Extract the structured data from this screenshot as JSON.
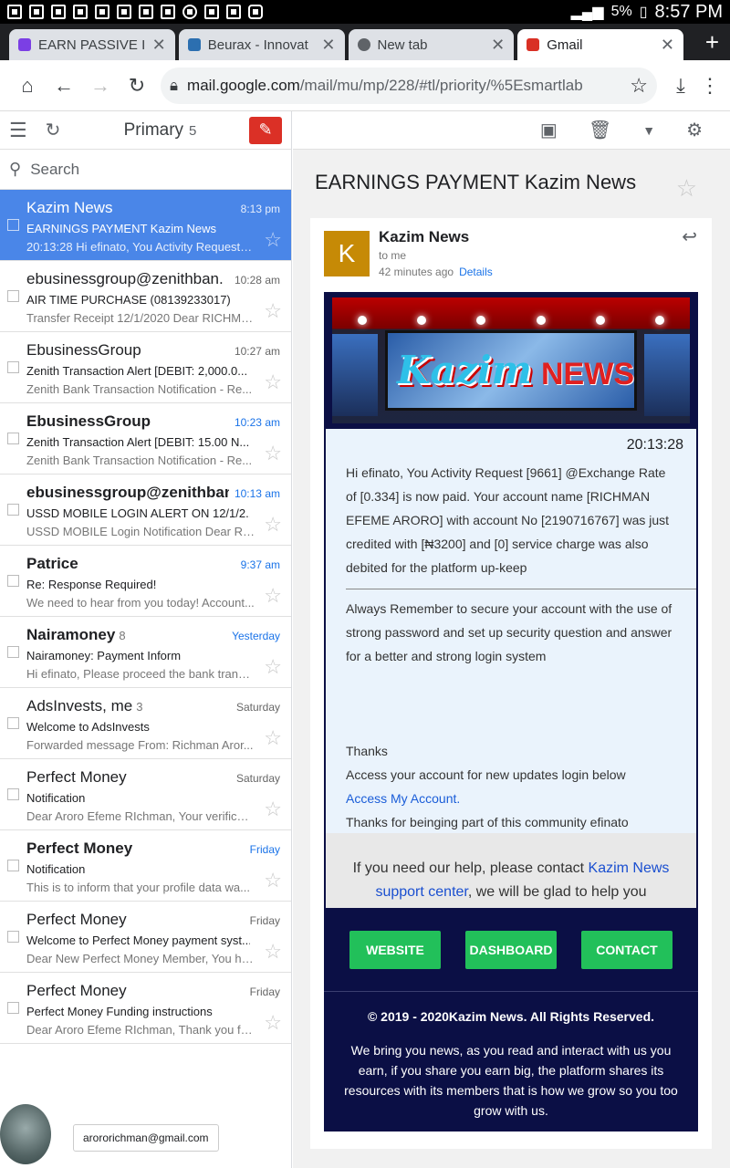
{
  "status_bar": {
    "battery": "5%",
    "time": "8:57 PM"
  },
  "tabs": [
    {
      "title": "EARN PASSIVE I",
      "favicon_color": "#7b3fe4",
      "active": false
    },
    {
      "title": "Beurax - Innovat",
      "favicon_color": "#2c6fb0",
      "active": false
    },
    {
      "title": "New tab",
      "favicon_color": "#5f6368",
      "active": false
    },
    {
      "title": "Gmail",
      "favicon_color": "#d93025",
      "active": true
    }
  ],
  "address_bar": {
    "url_host": "mail.google.com",
    "url_path": "/mail/mu/mp/228/#tl/priority/%5Esmartlab"
  },
  "inbox": {
    "folder": "Primary",
    "count": "5",
    "search_placeholder": "Search",
    "mails": [
      {
        "sender": "Kazim News",
        "thread_count": "",
        "time": "8:13 pm",
        "subject": "EARNINGS PAYMENT Kazim News",
        "snippet": "20:13:28 Hi efinato, You Activity Request [...",
        "unread": false,
        "time_blue": false,
        "selected": true
      },
      {
        "sender": "ebusinessgroup@zenithban.",
        "thread_count": "",
        "time": "10:28 am",
        "subject": "AIR TIME PURCHASE (08139233017)",
        "snippet": "Transfer Receipt 12/1/2020 Dear RICHMAN...",
        "unread": false,
        "time_blue": false,
        "selected": false
      },
      {
        "sender": "EbusinessGroup",
        "thread_count": "",
        "time": "10:27 am",
        "subject": "Zenith Transaction Alert [DEBIT: 2,000.0...",
        "snippet": "Zenith Bank Transaction Notification - Re...",
        "unread": false,
        "time_blue": false,
        "selected": false
      },
      {
        "sender": "EbusinessGroup",
        "thread_count": "",
        "time": "10:23 am",
        "subject": "Zenith Transaction Alert [DEBIT: 15.00 N...",
        "snippet": "Zenith Bank Transaction Notification - Re...",
        "unread": true,
        "time_blue": true,
        "selected": false
      },
      {
        "sender": "ebusinessgroup@zenithban.",
        "thread_count": "",
        "time": "10:13 am",
        "subject": "USSD MOBILE LOGIN ALERT ON 12/1/2...",
        "snippet": "USSD MOBILE Login Notification Dear RI...",
        "unread": true,
        "time_blue": true,
        "selected": false
      },
      {
        "sender": "Patrice",
        "thread_count": "",
        "time": "9:37 am",
        "subject": "Re: Response Required!",
        "snippet": "We need to hear from you today! Account...",
        "unread": true,
        "time_blue": true,
        "selected": false
      },
      {
        "sender": "Nairamoney",
        "thread_count": "8",
        "time": "Yesterday",
        "subject": "Nairamoney: Payment Inform",
        "snippet": "Hi efinato, Please proceed the bank transf...",
        "unread": true,
        "time_blue": true,
        "selected": false
      },
      {
        "sender": "AdsInvests, me",
        "thread_count": "3",
        "time": "Saturday",
        "subject": "Welcome to AdsInvests",
        "snippet": "Forwarded message From: Richman Aror...",
        "unread": false,
        "time_blue": false,
        "selected": false
      },
      {
        "sender": "Perfect Money",
        "thread_count": "",
        "time": "Saturday",
        "subject": "Notification",
        "snippet": "Dear Aroro Efeme RIchman, Your verificat...",
        "unread": false,
        "time_blue": false,
        "selected": false
      },
      {
        "sender": "Perfect Money",
        "thread_count": "",
        "time": "Friday",
        "subject": "Notification",
        "snippet": "This is to inform that your profile data wa...",
        "unread": true,
        "time_blue": true,
        "selected": false
      },
      {
        "sender": "Perfect Money",
        "thread_count": "",
        "time": "Friday",
        "subject": "Welcome to Perfect Money payment syst...",
        "snippet": "Dear New Perfect Money Member, You ha...",
        "unread": false,
        "time_blue": false,
        "selected": false
      },
      {
        "sender": "Perfect Money",
        "thread_count": "",
        "time": "Friday",
        "subject": "Perfect Money Funding instructions",
        "snippet": "Dear Aroro Efeme RIchman, Thank you fo...",
        "unread": false,
        "time_blue": false,
        "selected": false
      }
    ],
    "account_email": "arororichman@gmail.com"
  },
  "message": {
    "subject": "EARNINGS PAYMENT Kazim News",
    "avatar_letter": "K",
    "from": "Kazim News",
    "to": "to me",
    "age": "42 minutes ago",
    "details_link": "Details",
    "newsletter": {
      "logo_word": "Kazim",
      "logo_news": "NEWS",
      "time": "20:13:28",
      "para1": "Hi efinato, You Activity Request [9661] @Exchange Rate of [0.334] is now paid. Your account name [RICHMAN EFEME ARORO] with account No [2190716767] was just credited with [₦3200] and [0] service charge was also debited for the platform up-keep",
      "para2": "Always Remember to secure your account with the use of strong password and set up security question and answer for a better and strong login system",
      "thanks": "Thanks",
      "access_text": "Access your account for new updates login below",
      "access_link": "Access My Account.",
      "community": "Thanks for beinging part of this community efinato",
      "help_pre": "If you need our help, please contact ",
      "help_link": "Kazim News support center",
      "help_post": ", we will be glad to help you",
      "buttons": [
        "WEBSITE",
        "DASHBOARD",
        "CONTACT"
      ],
      "copyright": "© 2019 - 2020Kazim News. All Rights Reserved.",
      "about": "We bring you news, as you read and interact with us you earn, if you share you earn big, the platform shares its resources with its members that is how we grow so you too grow with us."
    }
  }
}
